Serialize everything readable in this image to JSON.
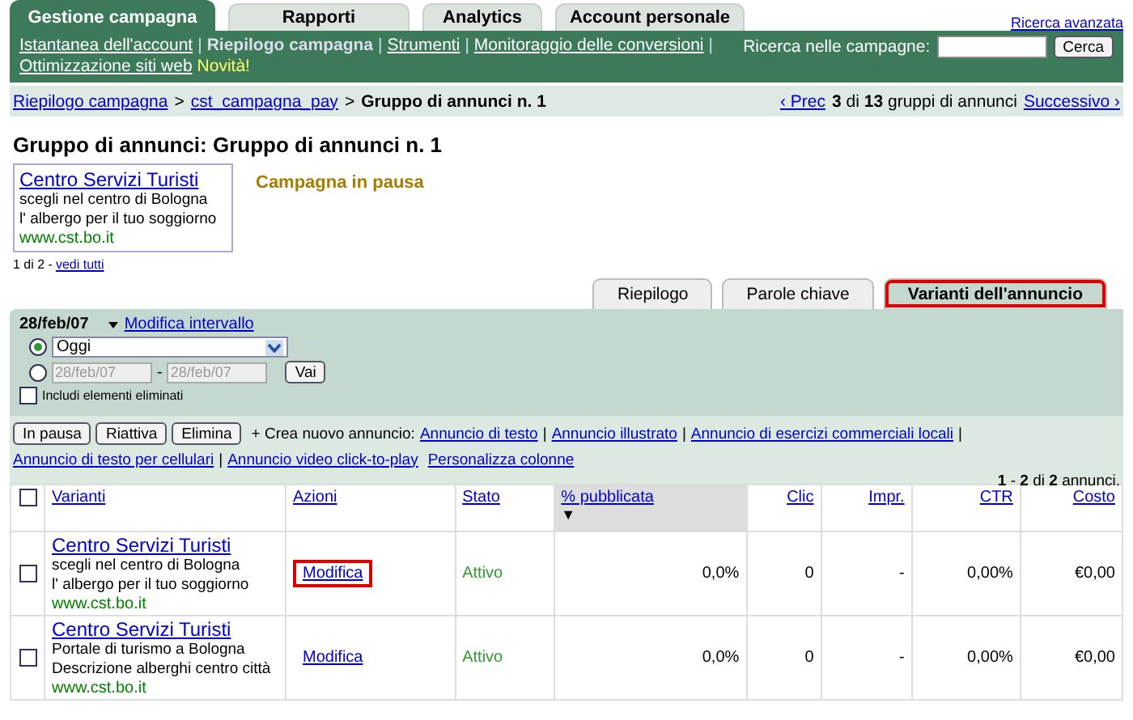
{
  "main_tabs": [
    {
      "label": "Gestione campagna",
      "selected": true
    },
    {
      "label": "Rapporti",
      "selected": false
    },
    {
      "label": "Analytics",
      "selected": false
    },
    {
      "label": "Account personale",
      "selected": false
    }
  ],
  "advanced_search_link": "Ricerca avanzata",
  "nav_links": [
    {
      "label": "Istantanea dell'account",
      "selected": false,
      "separator_after": "|"
    },
    {
      "label": "Riepilogo campagna",
      "selected": true,
      "separator_after": "|"
    },
    {
      "label": "Strumenti",
      "selected": false,
      "separator_after": "|"
    },
    {
      "label": "Monitoraggio delle conversioni",
      "selected": false,
      "separator_after": "|"
    },
    {
      "label": "Ottimizzazione siti web",
      "selected": false
    }
  ],
  "new_badge": "Novità!",
  "search": {
    "label": "Ricerca nelle campagne:",
    "button": "Cerca"
  },
  "breadcrumb": {
    "links": [
      {
        "label": "Riepilogo campagna",
        "separator_after": ">"
      },
      {
        "label": "cst_campagna_pay",
        "separator_after": ">"
      }
    ],
    "current": "Gruppo di annunci n. 1"
  },
  "pager": {
    "prev": "‹ Prec",
    "position": "**3** di **13** gruppi di annunci",
    "next": "Successivo ›"
  },
  "heading": "Gruppo di annunci: Gruppo di annunci n. 1",
  "ad_preview": {
    "title": "Centro Servizi Turisti",
    "line1": "scegli nel centro di Bologna",
    "line2": "l' albergo per il tuo soggiorno",
    "url": "www.cst.bo.it"
  },
  "campaign_status": "Campagna in pausa",
  "preview_count": "1 di 2 -",
  "view_all_link": "vedi tutti",
  "sub_tabs": [
    {
      "label": "Riepilogo",
      "selected": false,
      "highlighted": false
    },
    {
      "label": "Parole chiave",
      "selected": false,
      "highlighted": false
    },
    {
      "label": "Varianti dell'annuncio",
      "selected": true,
      "highlighted": true
    }
  ],
  "date_panel": {
    "date": "28/feb/07",
    "change_link": "Modifica intervallo",
    "preset": {
      "selected": true,
      "value": "Oggi"
    },
    "custom": {
      "selected": false,
      "from": "28/feb/07",
      "to": "28/feb/07",
      "dash": "-",
      "button": "Vai"
    },
    "include_deleted": {
      "label": "Includi elementi eliminati",
      "checked": false
    }
  },
  "actions": {
    "buttons": [
      "In pausa",
      "Riattiva",
      "Elimina"
    ],
    "create_label": "+ Crea nuovo annuncio:",
    "create_links": [
      {
        "label": "Annuncio di testo",
        "separator_after": "|"
      },
      {
        "label": "Annuncio illustrato",
        "separator_after": "|"
      },
      {
        "label": "Annuncio di esercizi commerciali locali",
        "separator_after": "|"
      },
      {
        "label": "Annuncio di testo per cellulari",
        "separator_after": "|"
      },
      {
        "label": "Annuncio video click-to-play"
      }
    ],
    "customize_link": "Personalizza colonne"
  },
  "result_count": "**1** - **2** di **2** annunci.",
  "table": {
    "select_all_checked": false,
    "columns": [
      {
        "label": "Varianti",
        "kind": "text",
        "sorted": false
      },
      {
        "label": "Azioni",
        "kind": "text",
        "sorted": false
      },
      {
        "label": "Stato",
        "kind": "text",
        "sorted": false
      },
      {
        "label": "% pubblicata",
        "kind": "text",
        "sorted": true,
        "sort_mark": "▼"
      },
      {
        "label": "Clic",
        "kind": "number",
        "sorted": false
      },
      {
        "label": "Impr.",
        "kind": "number",
        "sorted": false
      },
      {
        "label": "CTR",
        "kind": "number",
        "sorted": false
      },
      {
        "label": "Costo",
        "kind": "number",
        "sorted": false
      }
    ],
    "rows": [
      {
        "checked": false,
        "ad": {
          "title": "Centro Servizi Turisti",
          "line1": "scegli nel centro di Bologna",
          "line2": "l' albergo per il tuo soggiorno",
          "url": "www.cst.bo.it"
        },
        "action": "Modifica",
        "action_highlighted": true,
        "status": "Attivo",
        "served": "0,0%",
        "clicks": "0",
        "impressions": "-",
        "ctr": "0,00%",
        "cost": "€0,00"
      },
      {
        "checked": false,
        "ad": {
          "title": "Centro Servizi Turisti",
          "line1": "Portale di turismo a Bologna",
          "line2": "Descrizione alberghi centro città",
          "url": "www.cst.bo.it"
        },
        "action": "Modifica",
        "action_highlighted": false,
        "status": "Attivo",
        "served": "0,0%",
        "clicks": "0",
        "impressions": "-",
        "ctr": "0,00%",
        "cost": "€0,00"
      }
    ]
  }
}
